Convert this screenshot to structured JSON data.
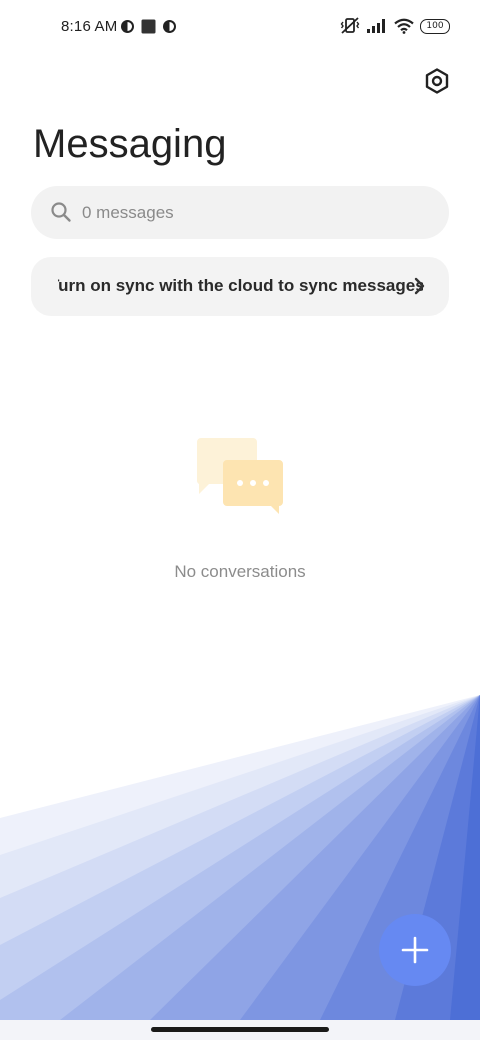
{
  "status_bar": {
    "time": "8:16 AM",
    "battery": "100",
    "left_icons": [
      "circle-half-icon",
      "square-icon",
      "circle-half-icon"
    ],
    "right_icons": [
      "vibrate-off-icon",
      "signal-icon",
      "wifi-icon",
      "battery-icon"
    ]
  },
  "header": {
    "title": "Messaging",
    "settings_icon": "gear-icon"
  },
  "search": {
    "placeholder": "0 messages",
    "icon": "search-icon"
  },
  "sync_banner": {
    "text": "Turn on sync with the cloud to sync messages",
    "icon": "chevron-right-icon"
  },
  "empty_state": {
    "illustration": "chat-bubbles-icon",
    "text": "No conversations"
  },
  "fab": {
    "icon": "plus-icon"
  },
  "colors": {
    "accent": "#6689f2",
    "fan_dark": "#4d6fd6",
    "illustration_back": "#fdf2d8",
    "illustration_front": "#fde4b1"
  }
}
